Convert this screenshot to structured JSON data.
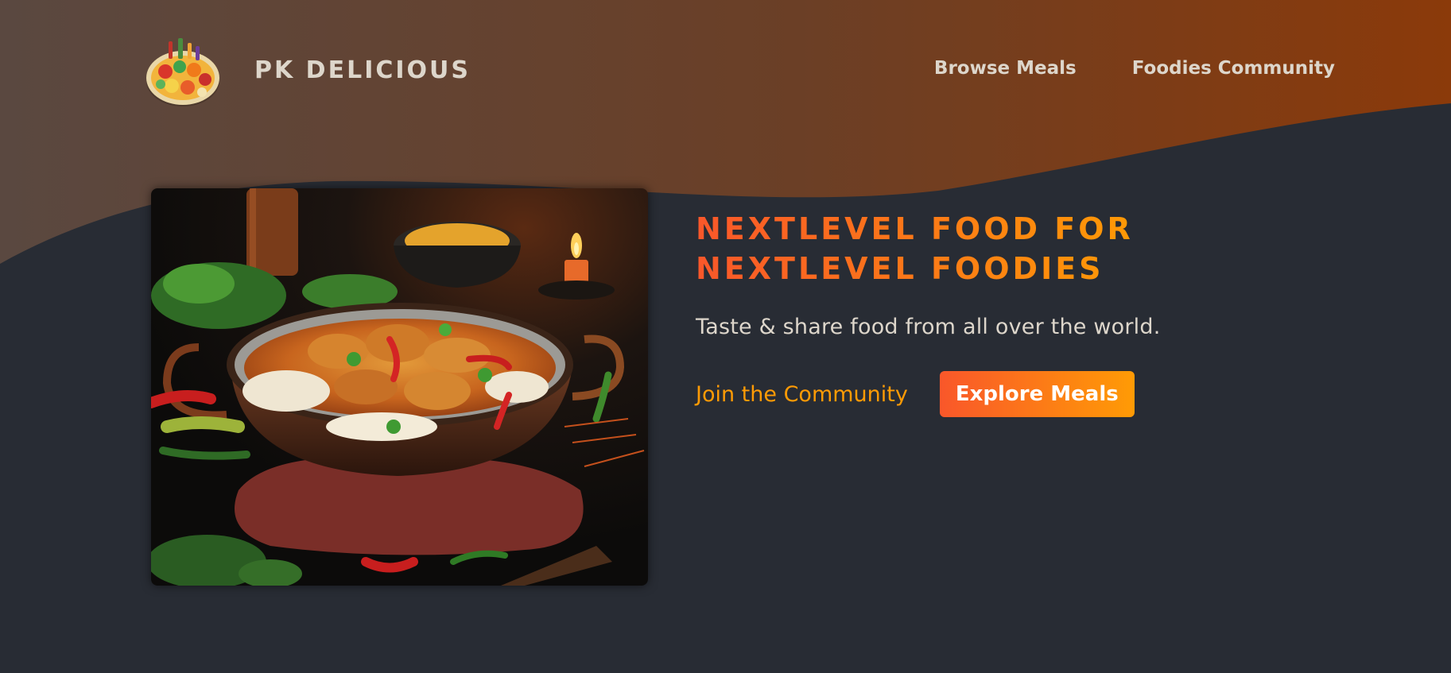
{
  "brand": {
    "name": "PK DELICIOUS",
    "logo_icon": "food-platter-icon"
  },
  "nav": {
    "items": [
      {
        "label": "Browse Meals"
      },
      {
        "label": "Foodies Community"
      }
    ]
  },
  "hero": {
    "title": "NEXTLEVEL FOOD FOR NEXTLEVEL FOODIES",
    "subtitle": "Taste & share food from all over the world.",
    "community_link": "Join the Community",
    "explore_button": "Explore Meals",
    "image_alt_icon": "curry-dish-image"
  },
  "colors": {
    "background": "#282c34",
    "header_gradient_start": "#5d4a40",
    "header_gradient_end": "#8a3f0c",
    "accent_start": "#f9572a",
    "accent_end": "#ff9b05",
    "text_light": "#ddd6cb"
  }
}
